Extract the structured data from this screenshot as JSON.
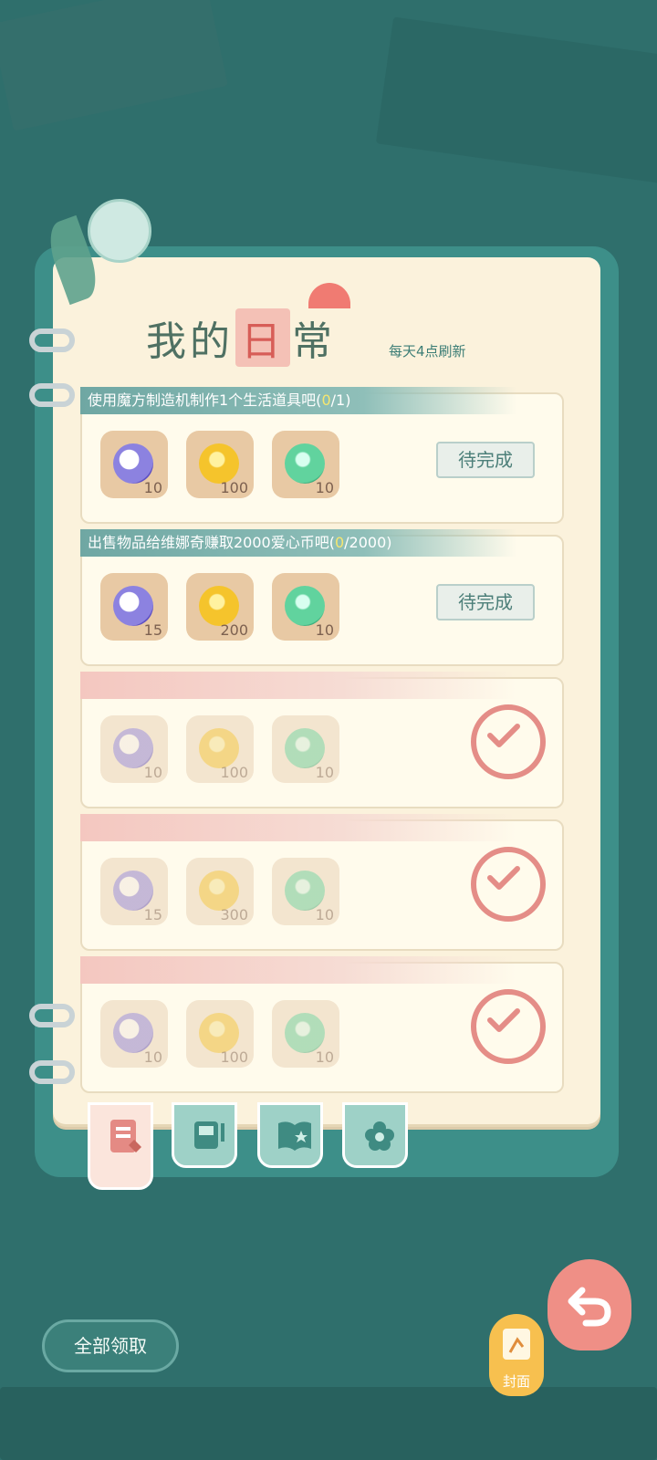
{
  "header": {
    "title_part1": "我的",
    "title_highlight": "日",
    "title_part2": "常",
    "refresh_note": "每天4点刷新"
  },
  "tasks": [
    {
      "title": "使用魔方制造机制作1个生活道具吧(",
      "progress": "0",
      "progress_tail": "/1)",
      "rewards": [
        {
          "icon": "moon-coin-icon",
          "count": "10"
        },
        {
          "icon": "gold-heart-coin-icon",
          "count": "100"
        },
        {
          "icon": "green-gem-icon",
          "count": "10"
        }
      ],
      "status_label": "待完成",
      "status": "pending"
    },
    {
      "title": "出售物品给维娜奇赚取2000爱心币吧(",
      "progress": "0",
      "progress_tail": "/2000)",
      "rewards": [
        {
          "icon": "moon-coin-icon",
          "count": "15"
        },
        {
          "icon": "gold-heart-coin-icon",
          "count": "200"
        },
        {
          "icon": "green-gem-icon",
          "count": "10"
        }
      ],
      "status_label": "待完成",
      "status": "pending"
    },
    {
      "title": "",
      "progress": "",
      "progress_tail": "",
      "rewards": [
        {
          "icon": "moon-coin-icon",
          "count": "10"
        },
        {
          "icon": "gold-heart-coin-icon",
          "count": "100"
        },
        {
          "icon": "green-gem-icon",
          "count": "10"
        }
      ],
      "status": "done"
    },
    {
      "title": "",
      "progress": "",
      "progress_tail": "",
      "rewards": [
        {
          "icon": "moon-coin-icon",
          "count": "15"
        },
        {
          "icon": "gold-heart-coin-icon",
          "count": "300"
        },
        {
          "icon": "green-gem-icon",
          "count": "10"
        }
      ],
      "status": "done"
    },
    {
      "title": "",
      "progress": "",
      "progress_tail": "",
      "rewards": [
        {
          "icon": "moon-coin-icon",
          "count": "10"
        },
        {
          "icon": "gold-heart-coin-icon",
          "count": "100"
        },
        {
          "icon": "green-gem-icon",
          "count": "10"
        }
      ],
      "status": "done"
    }
  ],
  "tabs": [
    {
      "icon": "daily-task-icon",
      "active": true
    },
    {
      "icon": "album-icon",
      "active": false
    },
    {
      "icon": "book-star-icon",
      "active": false
    },
    {
      "icon": "flower-badge-icon",
      "active": false
    }
  ],
  "buttons": {
    "claim_all": "全部领取",
    "cover": "封面",
    "back_icon": "back-arrow-icon"
  },
  "colors": {
    "background": "#2f6f6c",
    "page": "#fbf2dc",
    "accent_teal": "#6fa7a3",
    "accent_pink": "#e07a76",
    "gold": "#f5c42c"
  }
}
